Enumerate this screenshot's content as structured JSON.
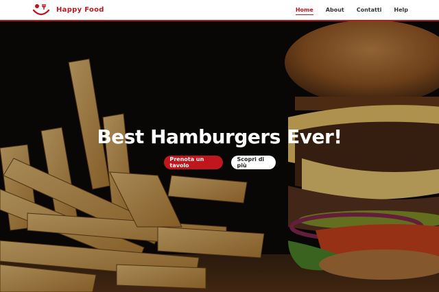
{
  "brand": {
    "name": "Happy Food",
    "accent": "#c0171c"
  },
  "nav": {
    "items": [
      {
        "label": "Home",
        "active": true
      },
      {
        "label": "About",
        "active": false
      },
      {
        "label": "Contatti",
        "active": false
      },
      {
        "label": "Help",
        "active": false
      }
    ]
  },
  "hero": {
    "headline": "Best Hamburgers Ever!",
    "primary_cta": "Prenota un tavolo",
    "secondary_cta": "Scopri di più",
    "background": "burger-and-fries-photo"
  }
}
